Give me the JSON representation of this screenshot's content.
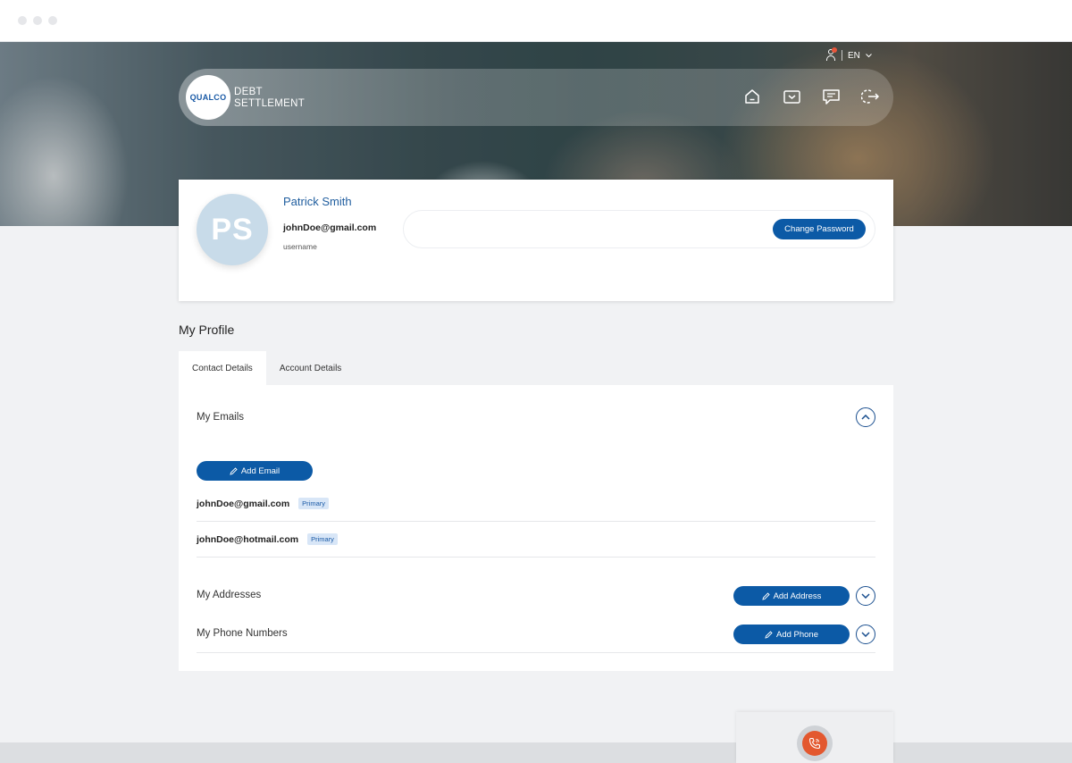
{
  "header": {
    "language": "EN",
    "logo_text": "QUALCO",
    "brand_line1": "DEBT",
    "brand_line2": "SETTLEMENT",
    "nav_icons": [
      "home-icon",
      "inbox-icon",
      "chat-icon",
      "logout-icon"
    ]
  },
  "profile": {
    "initials": "PS",
    "name": "Patrick Smith",
    "email": "johnDoe@gmail.com",
    "email_label": "username",
    "change_password_label": "Change Password"
  },
  "section_title": "My Profile",
  "tabs": [
    {
      "label": "Contact Details",
      "active": true
    },
    {
      "label": "Account Details",
      "active": false
    }
  ],
  "emails": {
    "title": "My Emails",
    "add_label": "Add Email",
    "items": [
      {
        "address": "johnDoe@gmail.com",
        "badge": "Primary"
      },
      {
        "address": "johnDoe@hotmail.com",
        "badge": "Primary"
      }
    ]
  },
  "addresses": {
    "title": "My Addresses",
    "add_label": "Add Address"
  },
  "phones": {
    "title": "My Phone Numbers",
    "add_label": "Add Phone"
  },
  "colors": {
    "primary": "#0c5aa6",
    "accent": "#e3582f",
    "name": "#1f5d9e"
  }
}
